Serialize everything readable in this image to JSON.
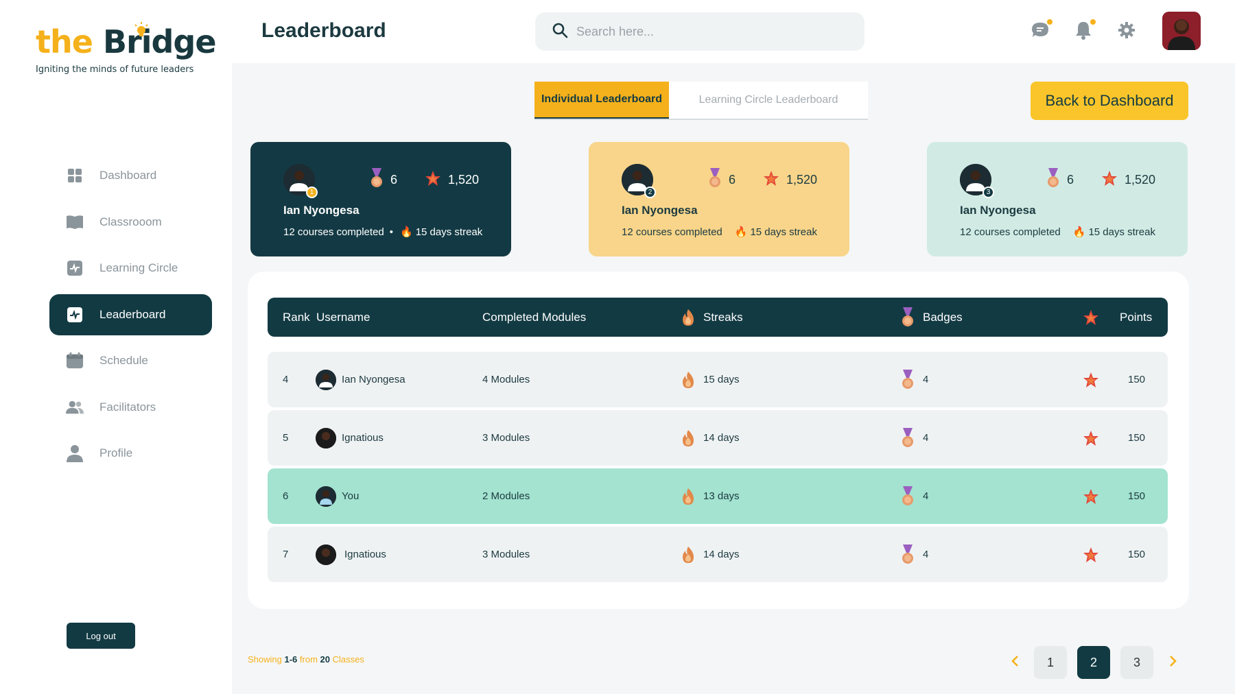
{
  "brand": {
    "logo_the": "the",
    "logo_bridge": "Bridge",
    "tagline": "Igniting the minds of future leaders"
  },
  "sidebar": {
    "items": [
      {
        "label": "Dashboard",
        "icon": "grid-icon"
      },
      {
        "label": "Classrooom",
        "icon": "book-icon"
      },
      {
        "label": "Learning Circle",
        "icon": "activity-icon"
      },
      {
        "label": "Leaderboard",
        "icon": "activity-icon",
        "active": true
      },
      {
        "label": "Schedule",
        "icon": "calendar-icon"
      },
      {
        "label": "Facilitators",
        "icon": "users-icon"
      },
      {
        "label": "Profile",
        "icon": "user-icon"
      }
    ],
    "logout_label": "Log out"
  },
  "header": {
    "title": "Leaderboard",
    "search_placeholder": "Search here..."
  },
  "tabs": {
    "individual": "Individual Leaderboard",
    "circle": "Learning Circle Leaderboard"
  },
  "back_label": "Back  to Dashboard",
  "top_cards": [
    {
      "rank": "1",
      "name": "Ian Nyongesa",
      "badges": "6",
      "points": "1,520",
      "courses": "12 courses completed",
      "separator": "•",
      "streak": "15 days streak"
    },
    {
      "rank": "2",
      "name": "Ian Nyongesa",
      "badges": "6",
      "points": "1,520",
      "courses": "12 courses completed",
      "streak": "15 days streak"
    },
    {
      "rank": "3",
      "name": "Ian Nyongesa",
      "badges": "6",
      "points": "1,520",
      "courses": "12 courses completed",
      "streak": "15 days streak"
    }
  ],
  "table": {
    "headers": {
      "rank": "Rank",
      "username": "Username",
      "modules": "Completed Modules",
      "streaks": "Streaks",
      "badges": "Badges",
      "points": "Points"
    },
    "rows": [
      {
        "rank": "4",
        "username": "Ian Nyongesa",
        "modules": "4 Modules",
        "streak": "15 days",
        "badges": "4",
        "points": "150"
      },
      {
        "rank": "5",
        "username": "Ignatious",
        "modules": "3 Modules",
        "streak": "14 days",
        "badges": "4",
        "points": "150"
      },
      {
        "rank": "6",
        "username": "You",
        "modules": "2 Modules",
        "streak": "13 days",
        "badges": "4",
        "points": "150"
      },
      {
        "rank": "7",
        "username": "Ignatious",
        "modules": "3 Modules",
        "streak": "14 days",
        "badges": "4",
        "points": "150"
      }
    ]
  },
  "pagination": {
    "showing_prefix": "Showing",
    "range": "1-6",
    "from_word": "from",
    "total": "20",
    "unit": "Classes",
    "pages": [
      "1",
      "2",
      "3"
    ],
    "current": "2"
  },
  "colors": {
    "primary": "#123a43",
    "accent": "#f5b11b",
    "highlight_row": "#a3e3d0"
  }
}
